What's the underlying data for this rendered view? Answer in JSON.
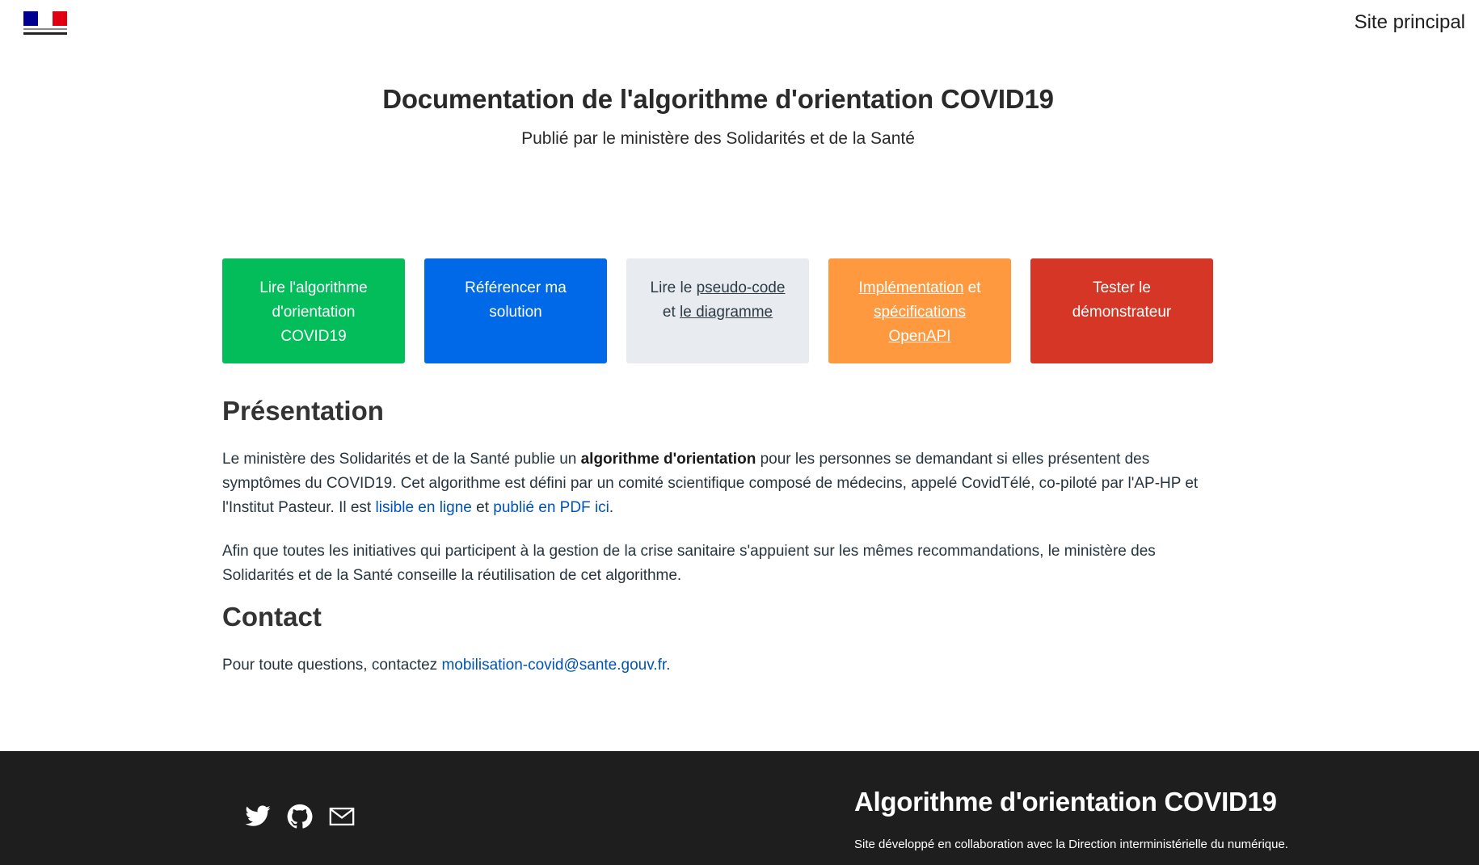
{
  "header": {
    "logo_text": "République Française",
    "site_principal_label": "Site principal"
  },
  "hero": {
    "title": "Documentation de l'algorithme d'orientation COVID19",
    "subtitle": "Publié par le ministère des Solidarités et de la Santé"
  },
  "cards": {
    "lire": {
      "label": "Lire l'algorithme d'orientation COVID19"
    },
    "referencer": {
      "label": "Référencer ma solution"
    },
    "pseudo": {
      "prefix": "Lire le ",
      "link1": "pseudo-code",
      "middle": " et ",
      "link2": "le diagramme"
    },
    "impl": {
      "link1": "Implémentation",
      "middle": " et ",
      "link2": "spécifications OpenAPI"
    },
    "tester": {
      "label": "Tester le démonstrateur"
    }
  },
  "presentation": {
    "heading": "Présentation",
    "p1_a": "Le ministère des Solidarités et de la Santé publie un ",
    "p1_bold": "algorithme d'orientation",
    "p1_b": " pour les personnes se demandant si elles présentent des symptômes du COVID19. Cet algorithme est défini par un comité scientifique composé de médecins, appelé CovidTélé, co-piloté par l'AP-HP et l'Institut Pasteur. Il est ",
    "p1_link1": "lisible en ligne",
    "p1_c": " et ",
    "p1_link2": "publié en PDF ici",
    "p1_d": ".",
    "p2": "Afin que toutes les initiatives qui participent à la gestion de la crise sanitaire s'appuient sur les mêmes recommandations, le ministère des Solidarités et de la Santé conseille la réutilisation de cet algorithme."
  },
  "contact": {
    "heading": "Contact",
    "text_a": "Pour toute questions, contactez ",
    "email": "mobilisation-covid@sante.gouv.fr",
    "text_b": "."
  },
  "footer": {
    "icons": [
      "twitter-icon",
      "github-icon",
      "mail-icon"
    ],
    "title": "Algorithme d'orientation COVID19",
    "description": "Site développé en collaboration avec la Direction interministérielle du numérique."
  },
  "colors": {
    "green": "#03bd5b",
    "blue": "#0069e7",
    "grey": "#e8ebef",
    "orange": "#ff9940",
    "red": "#d63626",
    "link": "#0053b3",
    "footer_bg": "#1e1e1e"
  }
}
